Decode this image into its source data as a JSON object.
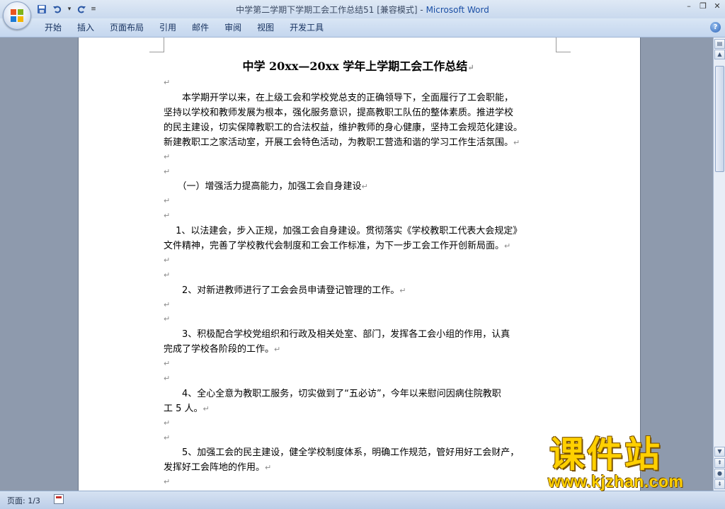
{
  "window": {
    "title_doc": "中学第二学期下学期工会工作总结51 [兼容模式] - ",
    "title_app": "Microsoft Word"
  },
  "quick_access": {
    "save_icon": "save-icon",
    "undo_icon": "undo-icon",
    "redo_icon": "redo-icon",
    "more_icon": "chevron-down-icon"
  },
  "ribbon": {
    "tabs": [
      "开始",
      "插入",
      "页面布局",
      "引用",
      "邮件",
      "审阅",
      "视图",
      "开发工具"
    ]
  },
  "document": {
    "title": "中学 20xx—20xx 学年上学期工会工作总结",
    "paragraph_mark": "↵",
    "intro_lines": [
      "　　本学期开学以来，在上级工会和学校党总支的正确领导下，全面履行了工会职能，",
      "坚持以学校和教师发展为根本，强化服务意识，提高教职工队伍的整体素质。推进学校",
      "的民主建设，切实保障教职工的合法权益，维护教师的身心健康，坚持工会规范化建设。",
      "新建教职工之家活动室，开展工会特色活动，为教职工营造和谐的学习工作生活氛围。"
    ],
    "section1": "　　（一）增强活力提高能力，加强工会自身建设",
    "item1_lines": [
      "　 1、以法建会，步入正规，加强工会自身建设。贯彻落实《学校教职工代表大会规定》",
      "文件精神，完善了学校教代会制度和工会工作标准，为下一步工会工作开创新局面。"
    ],
    "item2_lines": [
      "　　2、对新进教师进行了工会会员申请登记管理的工作。"
    ],
    "item3_lines": [
      "　　3、积极配合学校党组织和行政及相关处室、部门，发挥各工会小组的作用，认真",
      "完成了学校各阶段的工作。"
    ],
    "item4_lines": [
      "　　4、全心全意为教职工服务，切实做到了“五必访”，今年以来慰问因病住院教职",
      "工 5 人。"
    ],
    "item5_lines": [
      "　　5、加强工会的民主建设，健全学校制度体系，明确工作规范，管好用好工会财产，",
      "发挥好工会阵地的作用。"
    ]
  },
  "statusbar": {
    "page": "页面: 1/3"
  },
  "watermark": {
    "title": "课件站",
    "url": "www.kjzhan.com"
  }
}
